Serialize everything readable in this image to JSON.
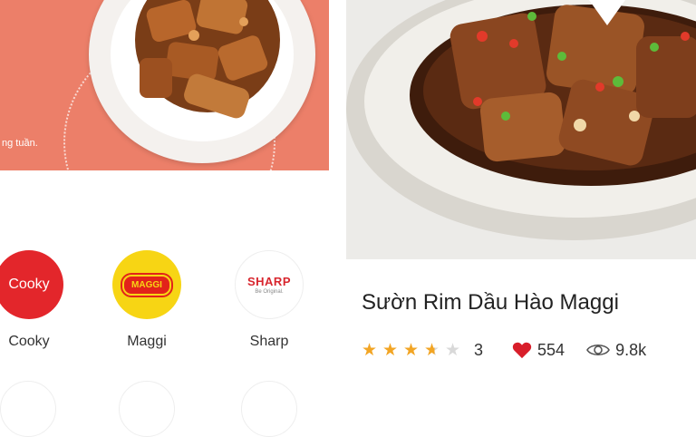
{
  "banner": {
    "caption": "ng tuần."
  },
  "brands": [
    {
      "name": "Cooky",
      "logo_text": "Cooky"
    },
    {
      "name": "Maggi",
      "logo_text": "MAGGI"
    },
    {
      "name": "Sharp",
      "logo_text": "SHARP",
      "logo_tagline": "Be Original."
    }
  ],
  "recipe": {
    "title": "Sườn Rim Dầu Hào Maggi",
    "rating_stars": 3.5,
    "rating_count": "3",
    "likes": "554",
    "views": "9.8k"
  },
  "colors": {
    "banner_bg": "#ec7f69",
    "cooky_red": "#e3262b",
    "maggi_yellow": "#f7d514",
    "star": "#f2a524",
    "heart": "#d81e2a"
  },
  "icons": [
    "heart-icon",
    "eye-icon",
    "star-icon",
    "play-icon"
  ]
}
